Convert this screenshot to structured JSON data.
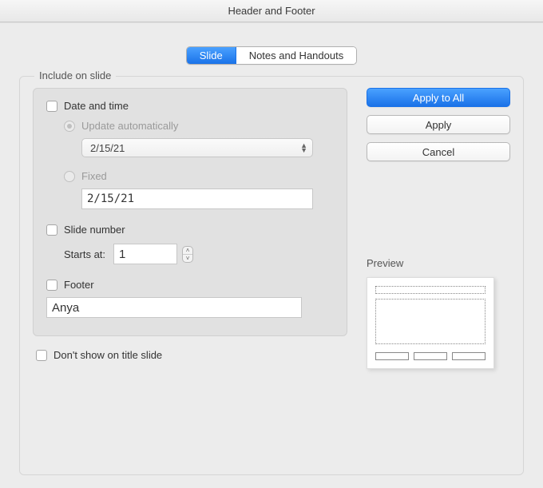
{
  "window": {
    "title": "Header and Footer"
  },
  "tabs": {
    "slide": "Slide",
    "notes": "Notes and Handouts"
  },
  "frame": {
    "legend": "Include on slide"
  },
  "datetime": {
    "label": "Date and time",
    "update_auto": "Update automatically",
    "auto_value": "2/15/21",
    "fixed_label": "Fixed",
    "fixed_value": "2/15/21"
  },
  "slidenum": {
    "label": "Slide number",
    "starts_at_label": "Starts at:",
    "starts_at_value": "1"
  },
  "footer": {
    "label": "Footer",
    "value": "Anya"
  },
  "notitle": {
    "label": "Don't show on title slide"
  },
  "buttons": {
    "apply_all": "Apply to All",
    "apply": "Apply",
    "cancel": "Cancel"
  },
  "preview": {
    "label": "Preview"
  }
}
